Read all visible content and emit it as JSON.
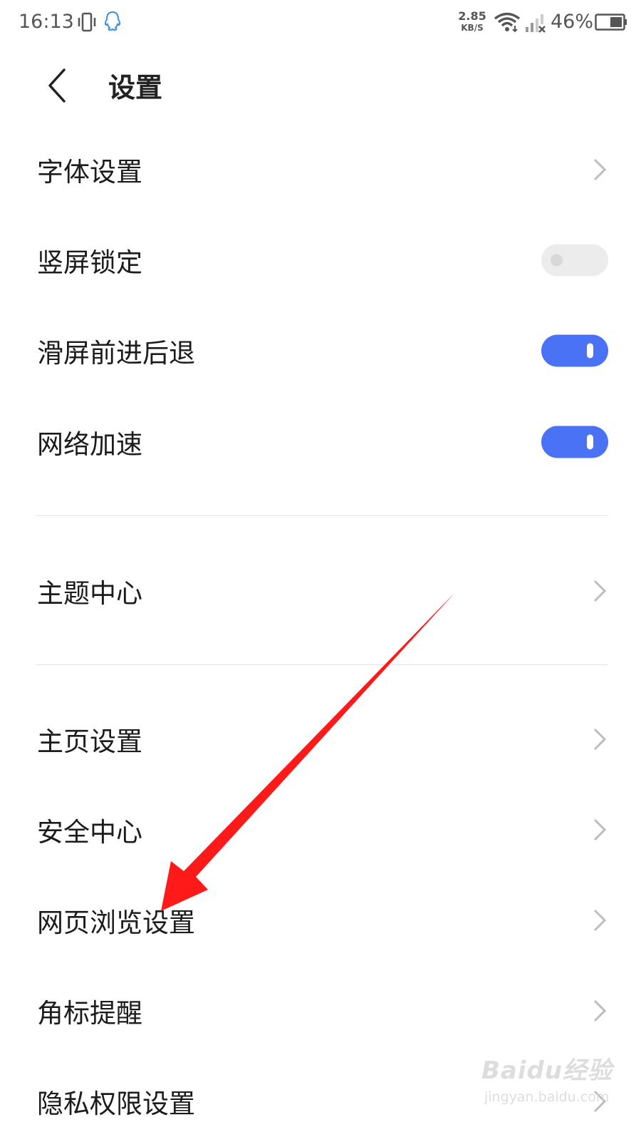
{
  "status_bar": {
    "time": "16:13",
    "net_speed_value": "2.85",
    "net_speed_unit": "KB/S",
    "battery_percent": "46%",
    "icons": [
      "vibrate-icon",
      "qq-icon",
      "wifi-icon",
      "signal-icon",
      "battery-icon"
    ]
  },
  "header": {
    "back_icon": "back-arrow-icon",
    "title": "设置"
  },
  "settings": [
    {
      "label": "字体设置",
      "control": "chevron"
    },
    {
      "label": "竖屏锁定",
      "control": "toggle",
      "on": false
    },
    {
      "label": "滑屏前进后退",
      "control": "toggle",
      "on": true
    },
    {
      "label": "网络加速",
      "control": "toggle",
      "on": true
    },
    {
      "label": "主题中心",
      "control": "chevron"
    },
    {
      "label": "主页设置",
      "control": "chevron"
    },
    {
      "label": "安全中心",
      "control": "chevron"
    },
    {
      "label": "网页浏览设置",
      "control": "chevron"
    },
    {
      "label": "角标提醒",
      "control": "chevron"
    },
    {
      "label": "隐私权限设置",
      "control": "chevron"
    }
  ],
  "colors": {
    "toggle_on": "#4a72f5",
    "toggle_off": "#ececec",
    "annotation_arrow": "#ff1a1a"
  },
  "watermark": {
    "brand": "Baidu经验",
    "url": "jingyan.baidu.com"
  }
}
